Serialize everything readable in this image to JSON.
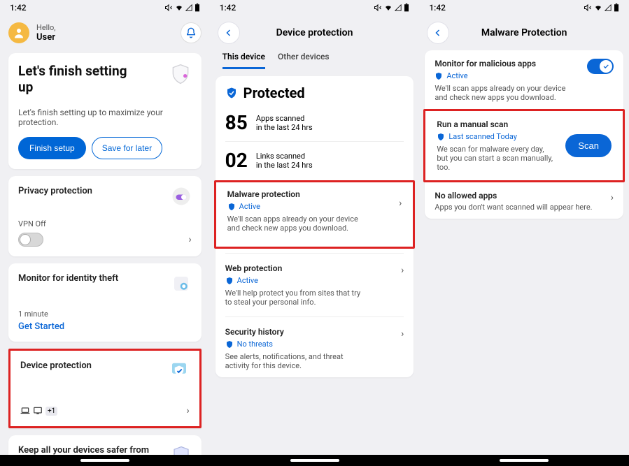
{
  "status_bar": {
    "time": "1:42"
  },
  "pane1": {
    "greeting_hello": "Hello,",
    "greeting_name": "User",
    "setup": {
      "title": "Let's finish setting up",
      "desc": "Let's finish setting up to maximize your protection.",
      "finish_btn": "Finish setup",
      "later_btn": "Save for later"
    },
    "privacy": {
      "title": "Privacy protection",
      "vpn_status": "VPN Off"
    },
    "identity": {
      "title": "Monitor for identity theft",
      "time_ago": "1 minute",
      "cta": "Get Started"
    },
    "device": {
      "title": "Device protection",
      "extra": "+1"
    },
    "keep_all": {
      "title": "Keep all your devices safer from threat"
    }
  },
  "pane2": {
    "header": "Device protection",
    "tabs": {
      "this": "This device",
      "other": "Other devices"
    },
    "protected_label": "Protected",
    "apps_num": "85",
    "apps_l1": "Apps scanned",
    "apps_l2": "in the last 24 hrs",
    "links_num": "02",
    "links_l1": "Links scanned",
    "links_l2": "in the last 24 hrs",
    "malware": {
      "title": "Malware protection",
      "status": "Active",
      "desc": "We'll scan apps already on your device and check new apps you download."
    },
    "web": {
      "title": "Web protection",
      "status": "Active",
      "desc": "We'll help protect you from sites that try to steal your personal info."
    },
    "history": {
      "title": "Security history",
      "status": "No threats",
      "desc": "See alerts, notifications, and threat activity for this device."
    }
  },
  "pane3": {
    "header": "Malware Protection",
    "monitor": {
      "title": "Monitor for malicious apps",
      "status": "Active",
      "desc": "We'll scan apps already on your device and check new apps you download."
    },
    "scan": {
      "title": "Run a manual scan",
      "status": "Last scanned Today",
      "desc": "We scan for malware every day, but you can start a scan manually, too.",
      "btn": "Scan"
    },
    "allowed": {
      "title": "No allowed apps",
      "desc": "Apps you don't want scanned will appear here."
    }
  }
}
